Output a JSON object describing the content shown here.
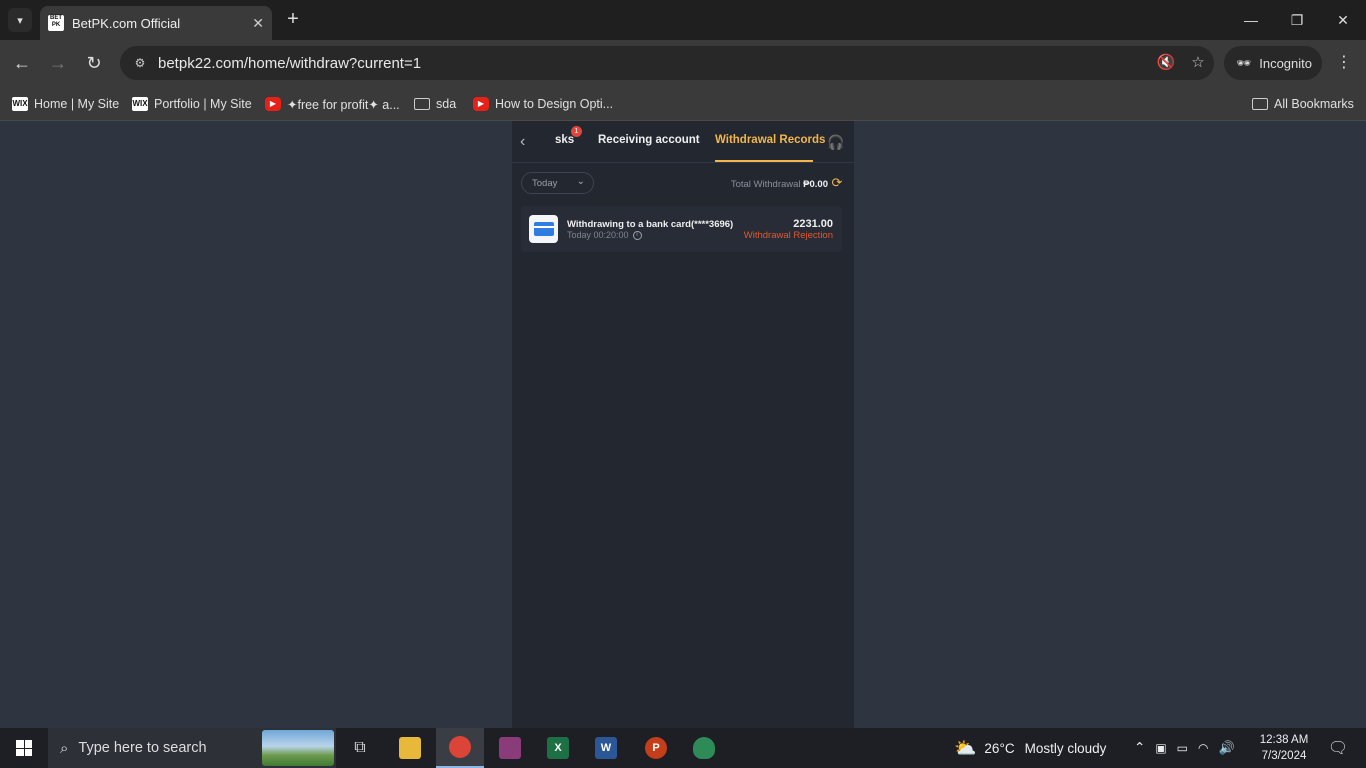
{
  "browser": {
    "tab_title": "BetPK.com Official",
    "favicon_text": "BET PK",
    "url": "betpk22.com/home/withdraw?current=1",
    "incognito_label": "Incognito",
    "bookmarks": [
      {
        "label": "Home | My Site",
        "icon": "wix-icon"
      },
      {
        "label": "Portfolio | My Site",
        "icon": "wix-icon"
      },
      {
        "label": "✦free for profit✦ a...",
        "icon": "youtube-icon"
      },
      {
        "label": "sda",
        "icon": "folder-icon"
      },
      {
        "label": "How to Design Opti...",
        "icon": "youtube-icon"
      }
    ],
    "all_bookmarks_label": "All Bookmarks"
  },
  "app": {
    "tabs": [
      {
        "label": "sks",
        "badge": "1"
      },
      {
        "label": "Receiving account"
      },
      {
        "label": "Withdrawal Records",
        "active": true
      }
    ],
    "filter": {
      "selected": "Today"
    },
    "total_label": "Total Withdrawal",
    "total_amount": "₱0.00",
    "records": [
      {
        "title": "Withdrawing to a bank card(****3696)",
        "time": "Today 00:20:00",
        "amount": "2231.00",
        "status": "Withdrawal Rejection"
      }
    ],
    "colors": {
      "accent": "#f2b64c",
      "rejection": "#e0582e",
      "panel": "#222730"
    }
  },
  "taskbar": {
    "search_placeholder": "Type here to search",
    "weather_temp": "26°C",
    "weather_desc": "Mostly cloudy",
    "time": "12:38 AM",
    "date": "7/3/2024"
  }
}
